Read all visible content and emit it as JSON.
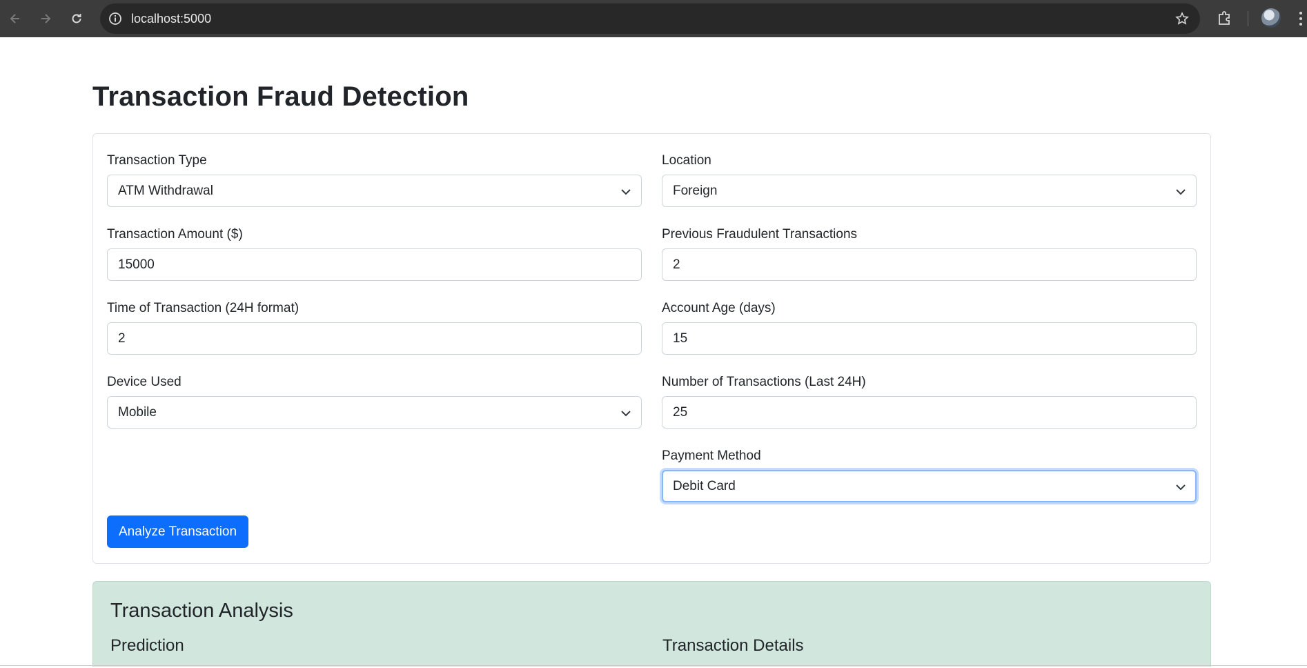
{
  "browser": {
    "url": "localhost:5000"
  },
  "page": {
    "title": "Transaction Fraud Detection"
  },
  "form": {
    "transaction_type": {
      "label": "Transaction Type",
      "value": "ATM Withdrawal"
    },
    "location": {
      "label": "Location",
      "value": "Foreign"
    },
    "amount": {
      "label": "Transaction Amount ($)",
      "value": "15000"
    },
    "previous_fraud": {
      "label": "Previous Fraudulent Transactions",
      "value": "2"
    },
    "time": {
      "label": "Time of Transaction (24H format)",
      "value": "2"
    },
    "account_age": {
      "label": "Account Age (days)",
      "value": "15"
    },
    "device": {
      "label": "Device Used",
      "value": "Mobile"
    },
    "num_transactions": {
      "label": "Number of Transactions (Last 24H)",
      "value": "25"
    },
    "payment_method": {
      "label": "Payment Method",
      "value": "Debit Card"
    },
    "submit_label": "Analyze Transaction"
  },
  "results": {
    "title": "Transaction Analysis",
    "prediction_heading": "Prediction",
    "details_heading": "Transaction Details"
  },
  "colors": {
    "primary": "#0d6efd",
    "success_bg": "#d1e7dd",
    "browser_chrome": "#3c3c3c"
  }
}
